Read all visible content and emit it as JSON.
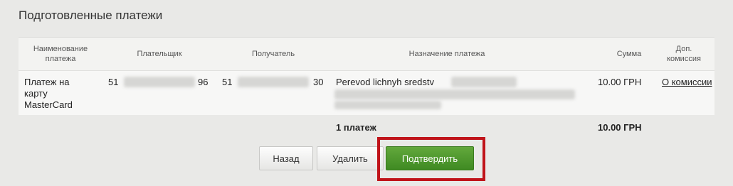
{
  "page": {
    "title": "Подготовленные платежи"
  },
  "table": {
    "headers": {
      "name": "Наименование платежа",
      "payer": "Плательщик",
      "recipient": "Получатель",
      "purpose": "Назначение платежа",
      "amount": "Сумма",
      "commission": "Доп. комиссия"
    },
    "row": {
      "name": "Платеж на карту MasterCard",
      "payer_prefix": "51",
      "payer_suffix": "96",
      "recipient_prefix": "51",
      "recipient_suffix": "30",
      "purpose": "Perevod lichnyh sredstv",
      "amount": "10.00 ГРН",
      "commission_link": "О комиссии"
    },
    "totals": {
      "count": "1 платеж",
      "amount": "10.00 ГРН"
    }
  },
  "buttons": {
    "back": "Назад",
    "delete": "Удалить",
    "confirm": "Подтвердить"
  },
  "colors": {
    "confirm": "#4f9a2d",
    "highlight": "#c0141a"
  }
}
